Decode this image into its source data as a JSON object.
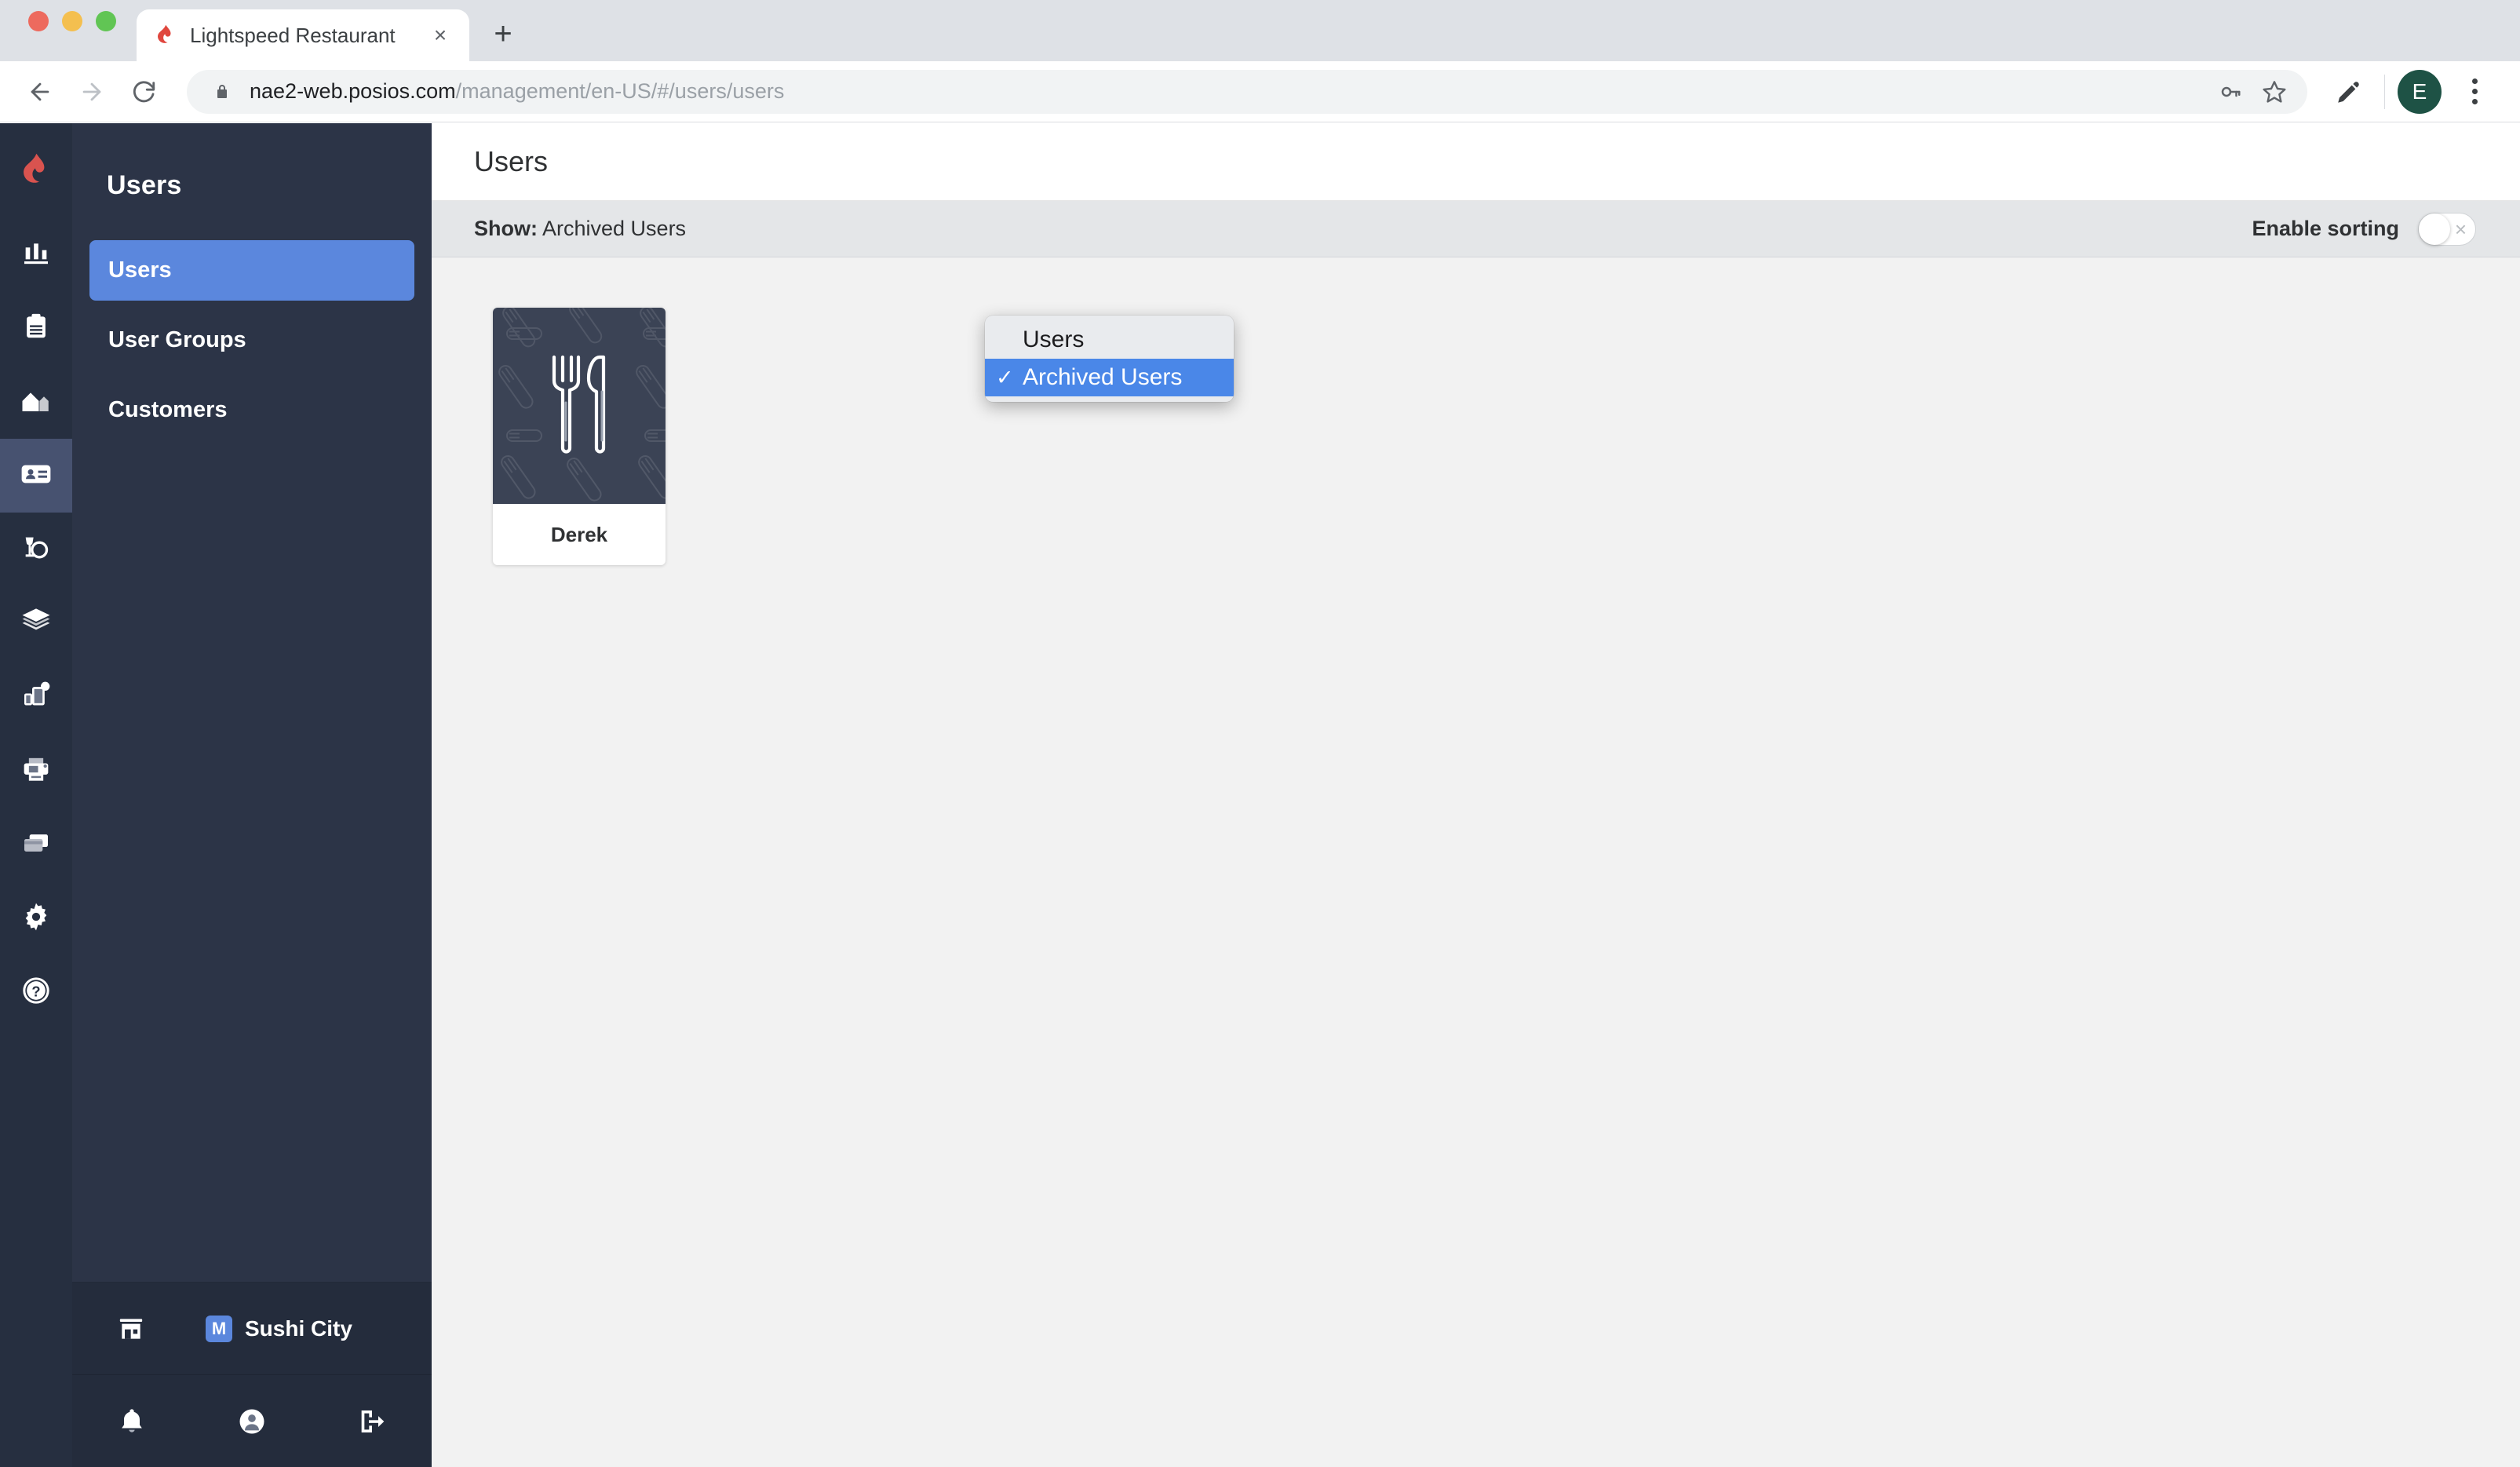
{
  "browser": {
    "tab": {
      "title": "Lightspeed Restaurant",
      "favicon": "lightspeed-flame-icon",
      "close": "×"
    },
    "newtab_label": "+",
    "url": {
      "scheme": "https://",
      "host": "nae2-web.posios.com",
      "path": "/management/en-US/#/users/users"
    },
    "icons": {
      "back": "back-arrow-icon",
      "forward": "forward-arrow-icon",
      "reload": "reload-icon",
      "lock": "lock-icon",
      "password": "key-icon",
      "bookmark": "star-icon",
      "extension": "pen-icon",
      "menu": "kebab-menu-icon"
    },
    "profile_initial": "E",
    "profile_color": "#1e5245"
  },
  "rail": {
    "logo": "lightspeed-logo",
    "items": [
      {
        "icon": "bar-chart-icon",
        "name": "reports",
        "active": false
      },
      {
        "icon": "clipboard-icon",
        "name": "orders",
        "active": false
      },
      {
        "icon": "floorplan-icon",
        "name": "floorplan",
        "active": false
      },
      {
        "icon": "id-card-icon",
        "name": "users",
        "active": true
      },
      {
        "icon": "plate-glass-icon",
        "name": "menu",
        "active": false
      },
      {
        "icon": "layers-icon",
        "name": "inventory",
        "active": false
      },
      {
        "icon": "devices-icon",
        "name": "devices",
        "active": false
      },
      {
        "icon": "printer-icon",
        "name": "printers",
        "active": false
      },
      {
        "icon": "payment-icon",
        "name": "payments",
        "active": false
      },
      {
        "icon": "gear-icon",
        "name": "settings",
        "active": false
      },
      {
        "icon": "help-icon",
        "name": "help",
        "active": false
      }
    ]
  },
  "sidebar": {
    "title": "Users",
    "items": [
      {
        "label": "Users",
        "active": true
      },
      {
        "label": "User Groups",
        "active": false
      },
      {
        "label": "Customers",
        "active": false
      }
    ],
    "store": {
      "badge": "M",
      "name": "Sushi City",
      "icon": "store-icon"
    },
    "footer": [
      {
        "icon": "bell-icon",
        "name": "notifications"
      },
      {
        "icon": "person-icon",
        "name": "account"
      },
      {
        "icon": "logout-icon",
        "name": "logout"
      }
    ]
  },
  "main": {
    "page_title": "Users",
    "filter": {
      "label": "Show:",
      "selected": "Archived Users",
      "options": [
        {
          "label": "Users",
          "selected": false
        },
        {
          "label": "Archived Users",
          "selected": true
        }
      ],
      "check_glyph": "✓"
    },
    "sorting": {
      "label": "Enable sorting",
      "enabled": false,
      "off_glyph": "×"
    },
    "users": [
      {
        "name": "Derek",
        "avatar": "cutlery-placeholder-icon"
      }
    ]
  },
  "colors": {
    "rail_bg": "#262f40",
    "nav_bg": "#2c3447",
    "accent_blue": "#5b87dd",
    "popup_highlight": "#4a87e8",
    "content_bg": "#f2f2f2",
    "filter_bar_bg": "#e4e6e8",
    "card_thumb_bg": "#3b4355",
    "brand_red": "#e0473e"
  }
}
